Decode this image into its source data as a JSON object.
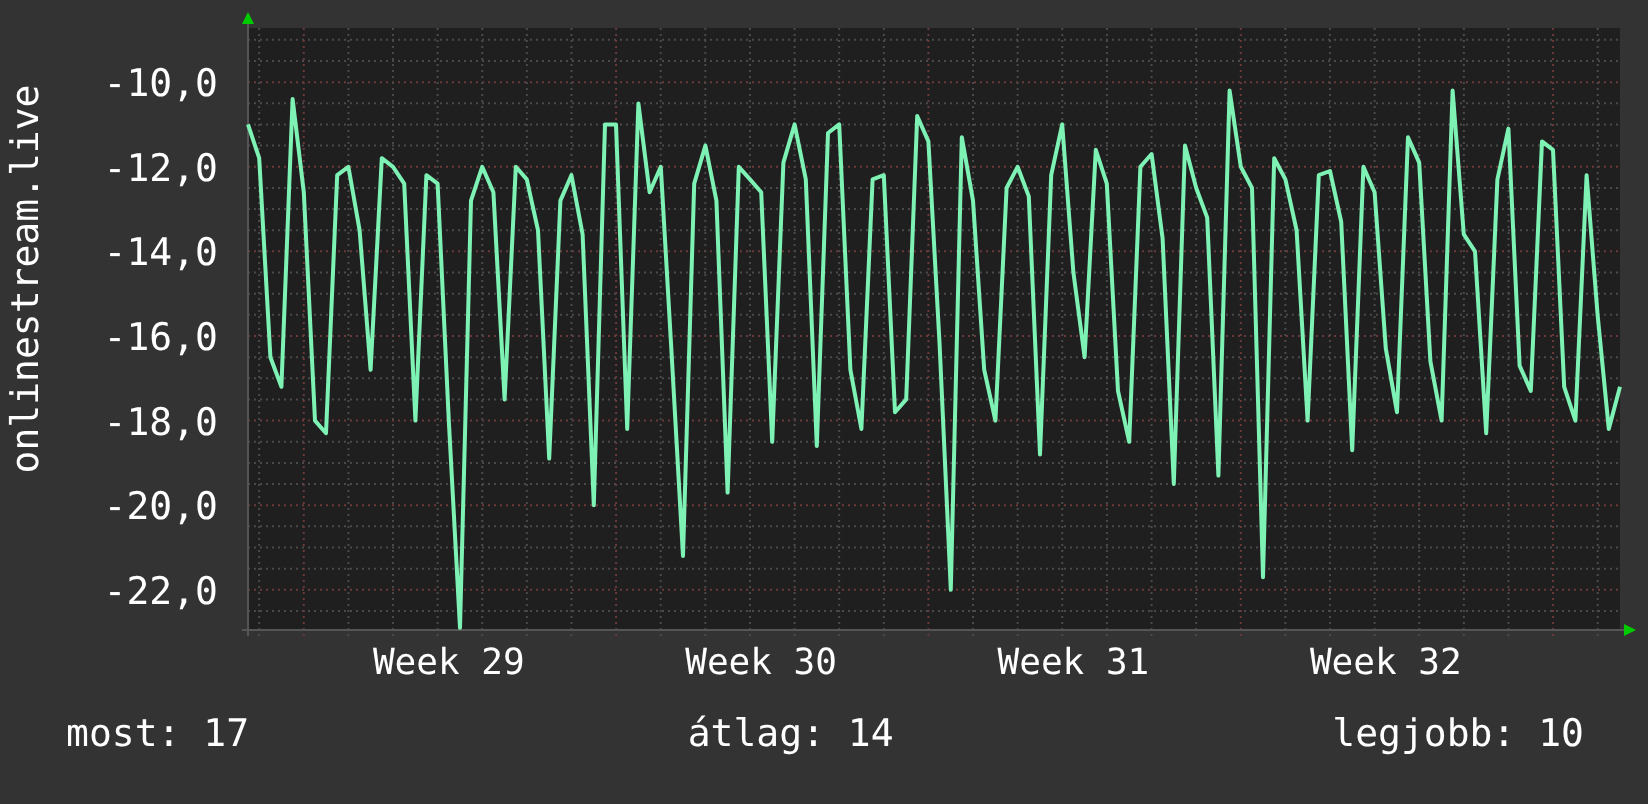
{
  "chart": {
    "chart_data": {
      "type": "line",
      "grid": true,
      "ylabel": "onlinestream.live",
      "ylim": [
        -22.95,
        -8.72
      ],
      "yticks": [
        {
          "value": -10,
          "label": "-10,0"
        },
        {
          "value": -12,
          "label": "-12,0"
        },
        {
          "value": -14,
          "label": "-14,0"
        },
        {
          "value": -16,
          "label": "-16,0"
        },
        {
          "value": -18,
          "label": "-18,0"
        },
        {
          "value": -20,
          "label": "-20,0"
        },
        {
          "value": -22,
          "label": "-22,0"
        }
      ],
      "categories": [
        null,
        null,
        null,
        null,
        null,
        null,
        null,
        null,
        null,
        null,
        null,
        null,
        null,
        null,
        null,
        null,
        null,
        null,
        "Week 29",
        null,
        null,
        null,
        null,
        null,
        null,
        null,
        null,
        null,
        null,
        null,
        null,
        null,
        null,
        null,
        null,
        null,
        null,
        null,
        null,
        null,
        null,
        null,
        null,
        null,
        null,
        null,
        "Week 30",
        null,
        null,
        null,
        null,
        null,
        null,
        null,
        null,
        null,
        null,
        null,
        null,
        null,
        null,
        null,
        null,
        null,
        null,
        null,
        null,
        null,
        null,
        null,
        null,
        null,
        null,
        null,
        "Week 31",
        null,
        null,
        null,
        null,
        null,
        null,
        null,
        null,
        null,
        null,
        null,
        null,
        null,
        null,
        null,
        null,
        null,
        null,
        null,
        null,
        null,
        null,
        null,
        null,
        null,
        null,
        null,
        "Week 32",
        null,
        null,
        null,
        null,
        null,
        null,
        null,
        null,
        null,
        null,
        null,
        null,
        null,
        null,
        null,
        null,
        null,
        null,
        null,
        null,
        null
      ],
      "series": [
        {
          "color": "#7ef2b4",
          "values": [
            -11,
            -11.8,
            -16.5,
            -17.2,
            -10.4,
            -12.6,
            -18,
            -18.3,
            -12.2,
            -12,
            -13.5,
            -16.8,
            -11.8,
            -12,
            -12.4,
            -18,
            -12.2,
            -12.4,
            -18,
            -22.9,
            -12.8,
            -12,
            -12.6,
            -17.5,
            -12,
            -12.3,
            -13.5,
            -18.9,
            -12.8,
            -12.2,
            -13.6,
            -20,
            -11,
            -11,
            -18.2,
            -10.5,
            -12.6,
            -12,
            -16.5,
            -21.2,
            -12.4,
            -11.5,
            -12.8,
            -19.7,
            -12,
            -12.3,
            -12.6,
            -18.5,
            -11.9,
            -11,
            -12.3,
            -18.6,
            -11.2,
            -11,
            -16.8,
            -18.2,
            -12.3,
            -12.2,
            -17.8,
            -17.5,
            -10.8,
            -11.4,
            -16.2,
            -22,
            -11.3,
            -12.8,
            -16.8,
            -18,
            -12.5,
            -12,
            -12.7,
            -18.8,
            -12.2,
            -11,
            -14.5,
            -16.5,
            -11.6,
            -12.4,
            -17.3,
            -18.5,
            -12,
            -11.7,
            -13.7,
            -19.5,
            -11.5,
            -12.5,
            -13.2,
            -19.3,
            -10.2,
            -12,
            -12.5,
            -21.7,
            -11.8,
            -12.3,
            -13.5,
            -18,
            -12.2,
            -12.1,
            -13.3,
            -18.7,
            -12,
            -12.6,
            -16.3,
            -17.8,
            -11.3,
            -11.9,
            -16.6,
            -18,
            -10.2,
            -13.6,
            -14,
            -18.3,
            -12.3,
            -11.1,
            -16.7,
            -17.3,
            -11.4,
            -11.6,
            -17.2,
            -18,
            -12.2,
            -15.5,
            -18.2,
            -17.2
          ]
        }
      ]
    }
  },
  "stats": [
    "most: 17",
    "átlag: 14",
    "legjobb: 10"
  ]
}
